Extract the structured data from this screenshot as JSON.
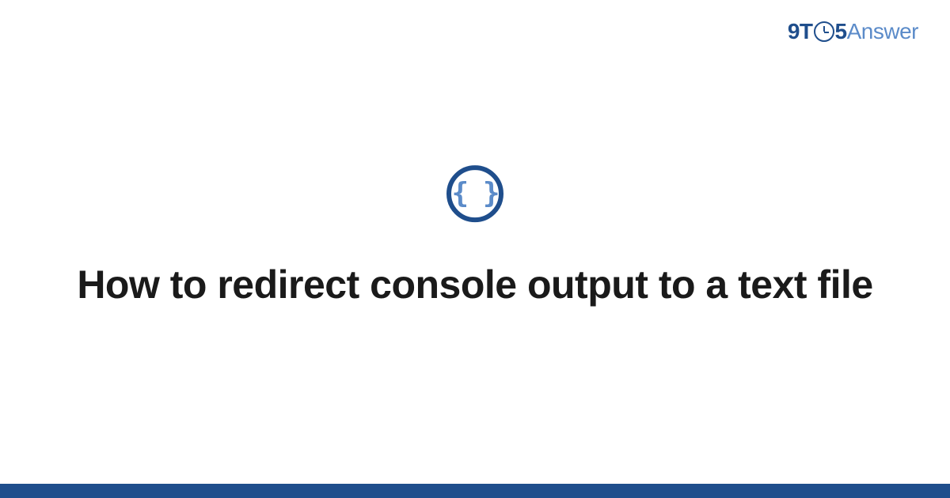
{
  "brand": {
    "part1": "9T",
    "part2": "5",
    "part3": "Answer"
  },
  "topic_icon": {
    "name": "code-braces",
    "glyph": "{ }"
  },
  "title": "How to redirect console output to a text file",
  "colors": {
    "primary": "#1f4e8c",
    "secondary": "#5b8bc9"
  }
}
